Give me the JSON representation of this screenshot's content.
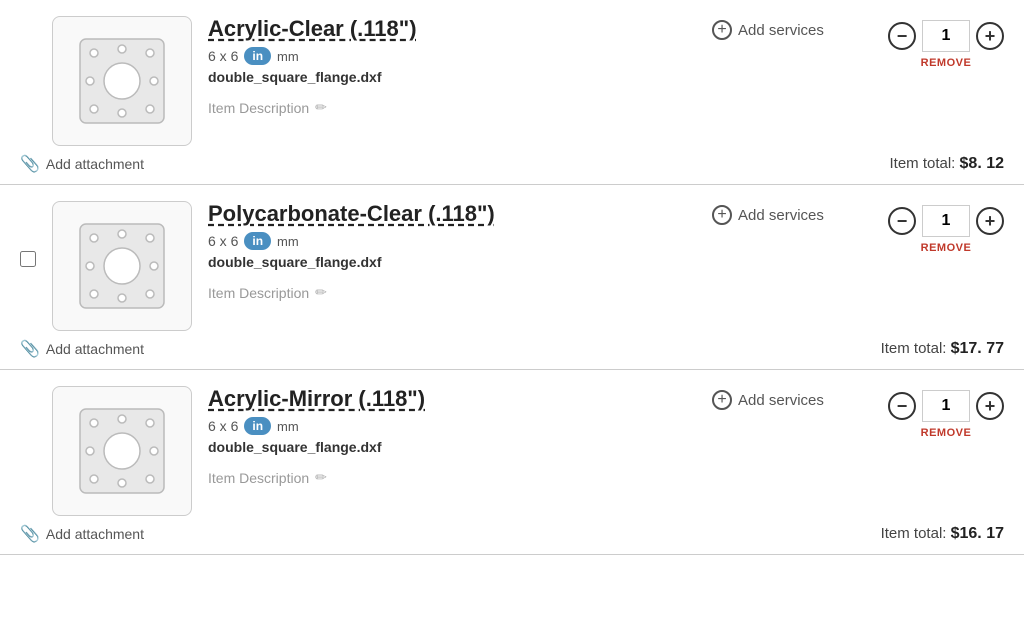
{
  "items": [
    {
      "id": "item-1",
      "name": "Acrylic-Clear (.118\")",
      "dimensions": "6 x 6",
      "unit": "in",
      "unit_label": "mm",
      "filename": "double_square_flange.dxf",
      "description_label": "Item Description",
      "add_services_label": "Add services",
      "quantity": "1",
      "remove_label": "REMOVE",
      "add_attachment_label": "Add attachment",
      "item_total_prefix": "Item total:",
      "item_total": "$8. 12",
      "show_checkbox": false
    },
    {
      "id": "item-2",
      "name": "Polycarbonate-Clear (.118\")",
      "dimensions": "6 x 6",
      "unit": "in",
      "unit_label": "mm",
      "filename": "double_square_flange.dxf",
      "description_label": "Item Description",
      "add_services_label": "Add services",
      "quantity": "1",
      "remove_label": "REMOVE",
      "add_attachment_label": "Add attachment",
      "item_total_prefix": "Item total:",
      "item_total": "$17. 77",
      "show_checkbox": true
    },
    {
      "id": "item-3",
      "name": "Acrylic-Mirror (.118\")",
      "dimensions": "6 x 6",
      "unit": "in",
      "unit_label": "mm",
      "filename": "double_square_flange.dxf",
      "description_label": "Item Description",
      "add_services_label": "Add services",
      "quantity": "1",
      "remove_label": "REMOVE",
      "add_attachment_label": "Add attachment",
      "item_total_prefix": "Item total:",
      "item_total": "$16. 17",
      "show_checkbox": false
    }
  ],
  "icons": {
    "paperclip": "📎",
    "plus_circle": "+",
    "edit": "✏"
  }
}
